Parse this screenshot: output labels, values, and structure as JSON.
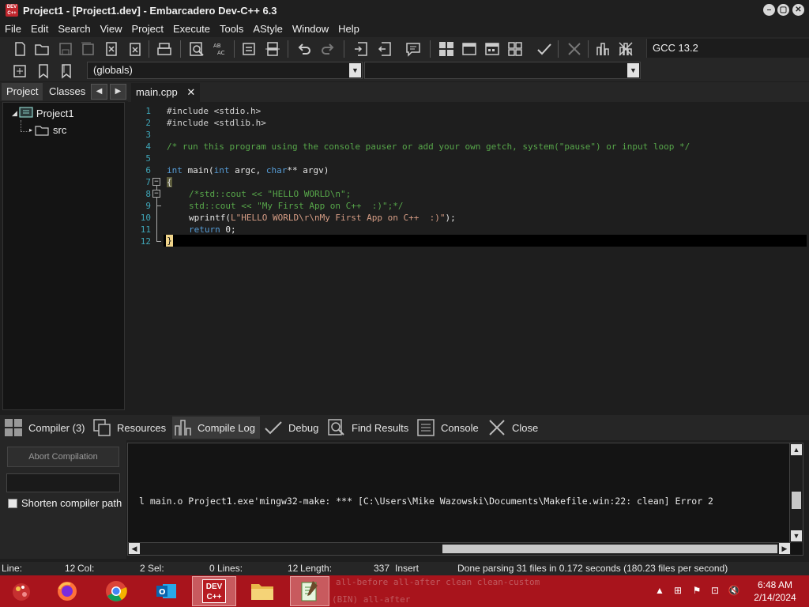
{
  "window": {
    "logo_text": "DEV C++",
    "title": "Project1 - [Project1.dev] - Embarcadero Dev-C++ 6.3"
  },
  "menu": [
    "File",
    "Edit",
    "Search",
    "View",
    "Project",
    "Execute",
    "Tools",
    "AStyle",
    "Window",
    "Help"
  ],
  "toolbar": {
    "compiler": "GCC 13.2",
    "globals_combo": "(globals)",
    "second_combo": ""
  },
  "left_panel": {
    "tabs": [
      "Project",
      "Classes"
    ],
    "tree": {
      "project": "Project1",
      "folder": "src"
    }
  },
  "editor": {
    "tab_label": "main.cpp",
    "line_numbers": [
      "1",
      "2",
      "3",
      "4",
      "5",
      "6",
      "7",
      "8",
      "9",
      "10",
      "11",
      "12"
    ],
    "lines": {
      "l1": "#include <stdio.h>",
      "l2": "#include <stdlib.h>",
      "l4": "/* run this program using the console pauser or add your own getch, system(\"pause\") or input loop */",
      "l6_kw1": "int",
      "l6_a": " main(",
      "l6_kw2": "int",
      "l6_b": " argc, ",
      "l6_kw3": "char",
      "l6_c": "** argv)",
      "l7": "{",
      "l8": "/*std::cout << \"HELLO WORLD\\n\";",
      "l9": "std::cout << \"My First App on C++  :)\";*/",
      "l10_a": "wprintf(",
      "l10_str": "L\"HELLO WORLD\\r\\nMy First App on C++  :)\"",
      "l10_b": ");",
      "l11_kw": "return",
      "l11_b": " 0;",
      "l12": "}"
    }
  },
  "bottom": {
    "tabs": {
      "compiler": "Compiler (3)",
      "resources": "Resources",
      "compile_log": "Compile Log",
      "debug": "Debug",
      "find_results": "Find Results",
      "console": "Console",
      "close": "Close"
    },
    "abort_label": "Abort Compilation",
    "shorten_label": "Shorten compiler path",
    "log_text": "l main.o Project1.exe'mingw32-make: *** [C:\\Users\\Mike Wazowski\\Documents\\Makefile.win:22: clean] Error 2"
  },
  "status": {
    "line_label": "Line:",
    "line_val": "12",
    "col_label": "Col:",
    "col_val": "2",
    "sel_label": "Sel:",
    "sel_val": "0",
    "lines_label": "Lines:",
    "lines_val": "12",
    "length_label": "Length:",
    "length_val": "337",
    "mode": "Insert",
    "message": "Done parsing 31 files in 0.172 seconds (180.23 files per second)"
  },
  "taskbar": {
    "ghost_text": "all-before all-after clean clean-custom",
    "ghost_text2": "(BIN) all-after",
    "devcpp_label": "DEV C++",
    "time": "6:48 AM",
    "date": "2/14/2024"
  },
  "colors": {
    "taskbar": "#a8141c",
    "accent_logo": "#c0262d",
    "line_numbers": "#3fa6b8",
    "comment": "#57a64a",
    "keyword": "#569cd6"
  }
}
